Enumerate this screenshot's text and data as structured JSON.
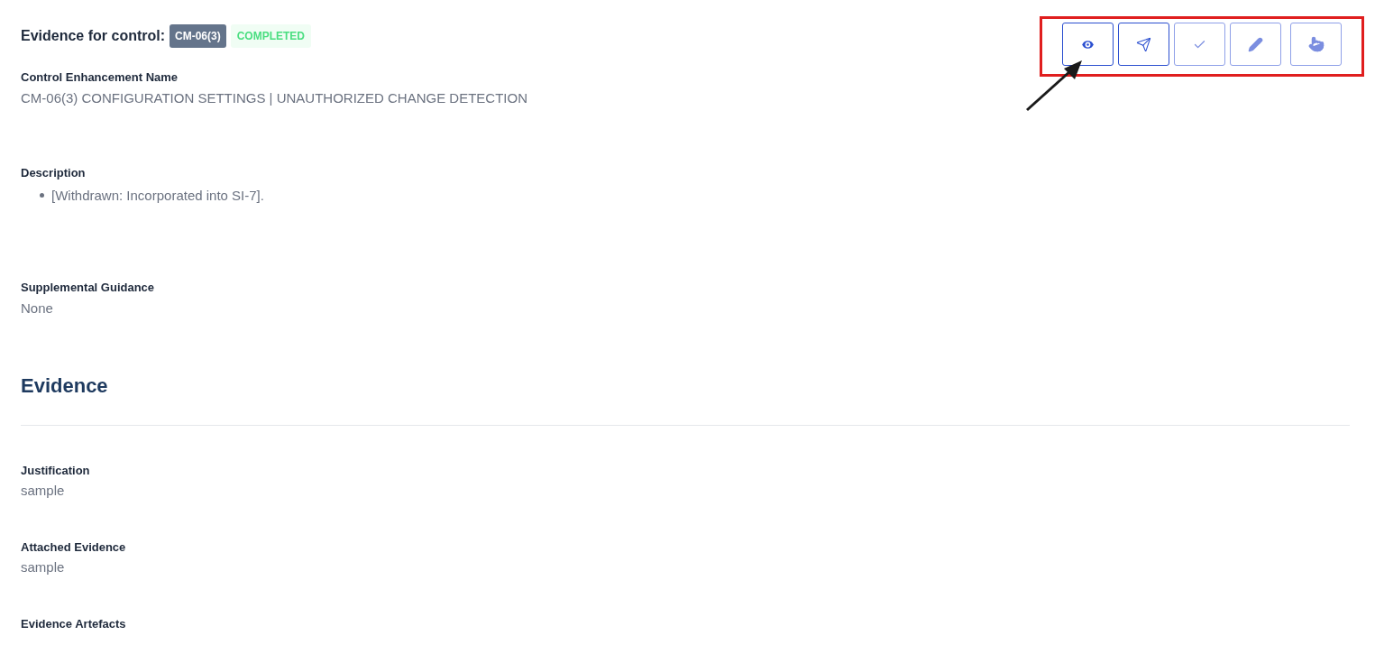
{
  "header": {
    "title": "Evidence for control:",
    "control_badge": "CM-06(3)",
    "status_badge": "COMPLETED"
  },
  "actions": [
    {
      "kind": "view",
      "disabled": false
    },
    {
      "kind": "send",
      "disabled": false
    },
    {
      "kind": "check",
      "disabled": true
    },
    {
      "kind": "edit",
      "disabled": true
    },
    {
      "kind": "pointer",
      "disabled": true
    }
  ],
  "fields": [
    {
      "label": "Control Enhancement Name",
      "kind": "text",
      "value": "CM-06(3) CONFIGURATION SETTINGS | UNAUTHORIZED CHANGE DETECTION"
    },
    {
      "label": "Description",
      "kind": "list",
      "items": [
        "[Withdrawn: Incorporated into SI-7]."
      ]
    },
    {
      "label": "Supplemental Guidance",
      "kind": "text",
      "value": "None"
    }
  ],
  "section_title": "Evidence",
  "evidence_fields": [
    {
      "label": "Justification",
      "value": "sample"
    },
    {
      "label": "Attached Evidence",
      "value": "sample"
    },
    {
      "label": "Evidence Artefacts"
    }
  ]
}
